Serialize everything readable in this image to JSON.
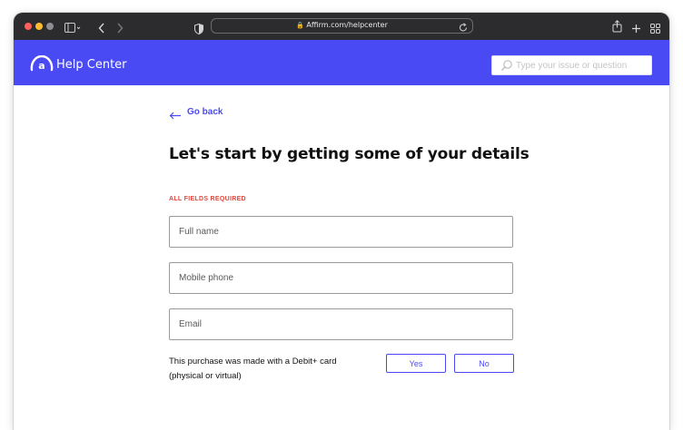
{
  "browser": {
    "url": "Affirm.com/helpcenter"
  },
  "header": {
    "brand": "Help Center",
    "search_placeholder": "Type your issue or question"
  },
  "form": {
    "back_label": "Go back",
    "heading": "Let's start by getting some of your details",
    "required_note": "ALL FIELDS REQUIRED",
    "fields": [
      {
        "placeholder": "Full name",
        "value": ""
      },
      {
        "placeholder": "Mobile phone",
        "value": ""
      },
      {
        "placeholder": "Email",
        "value": ""
      }
    ],
    "question_line1": "This purchase was made with a Debit+ card",
    "question_line2": "(physical or virtual)",
    "yes_label": "Yes",
    "no_label": "No"
  },
  "colors": {
    "brand": "#4a4af4",
    "required": "#e0473c"
  },
  "icons": [
    "sidebar-icon",
    "back-icon",
    "forward-icon",
    "shield-icon",
    "lock-icon",
    "reload-icon",
    "share-icon",
    "new-tab-icon",
    "tab-overview-icon",
    "affirm-logo",
    "search-icon",
    "arrow-left-icon"
  ]
}
